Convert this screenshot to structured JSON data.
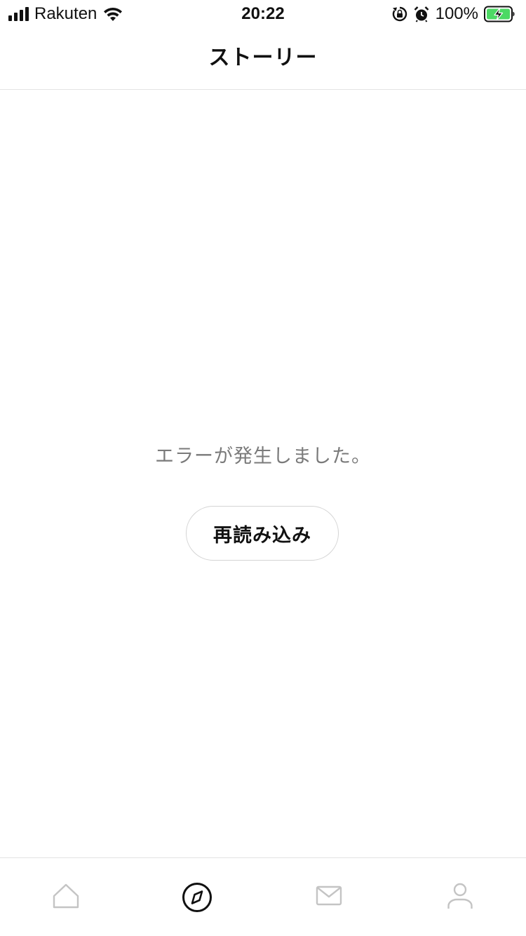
{
  "status_bar": {
    "carrier": "Rakuten",
    "time": "20:22",
    "battery": "100%",
    "icons": [
      "signal-icon",
      "wifi-icon",
      "orientation-lock-icon",
      "alarm-icon",
      "battery-charging-icon"
    ],
    "battery_color": "#4cd964"
  },
  "header": {
    "title": "ストーリー"
  },
  "main": {
    "error_message": "エラーが発生しました。",
    "reload_label": "再読み込み"
  },
  "tab_bar": {
    "tabs": [
      {
        "icon": "home-icon",
        "active": false
      },
      {
        "icon": "compass-icon",
        "active": true
      },
      {
        "icon": "mail-icon",
        "active": false
      },
      {
        "icon": "profile-icon",
        "active": false
      }
    ],
    "active_color": "#111111",
    "inactive_color": "#c4c4c4"
  }
}
